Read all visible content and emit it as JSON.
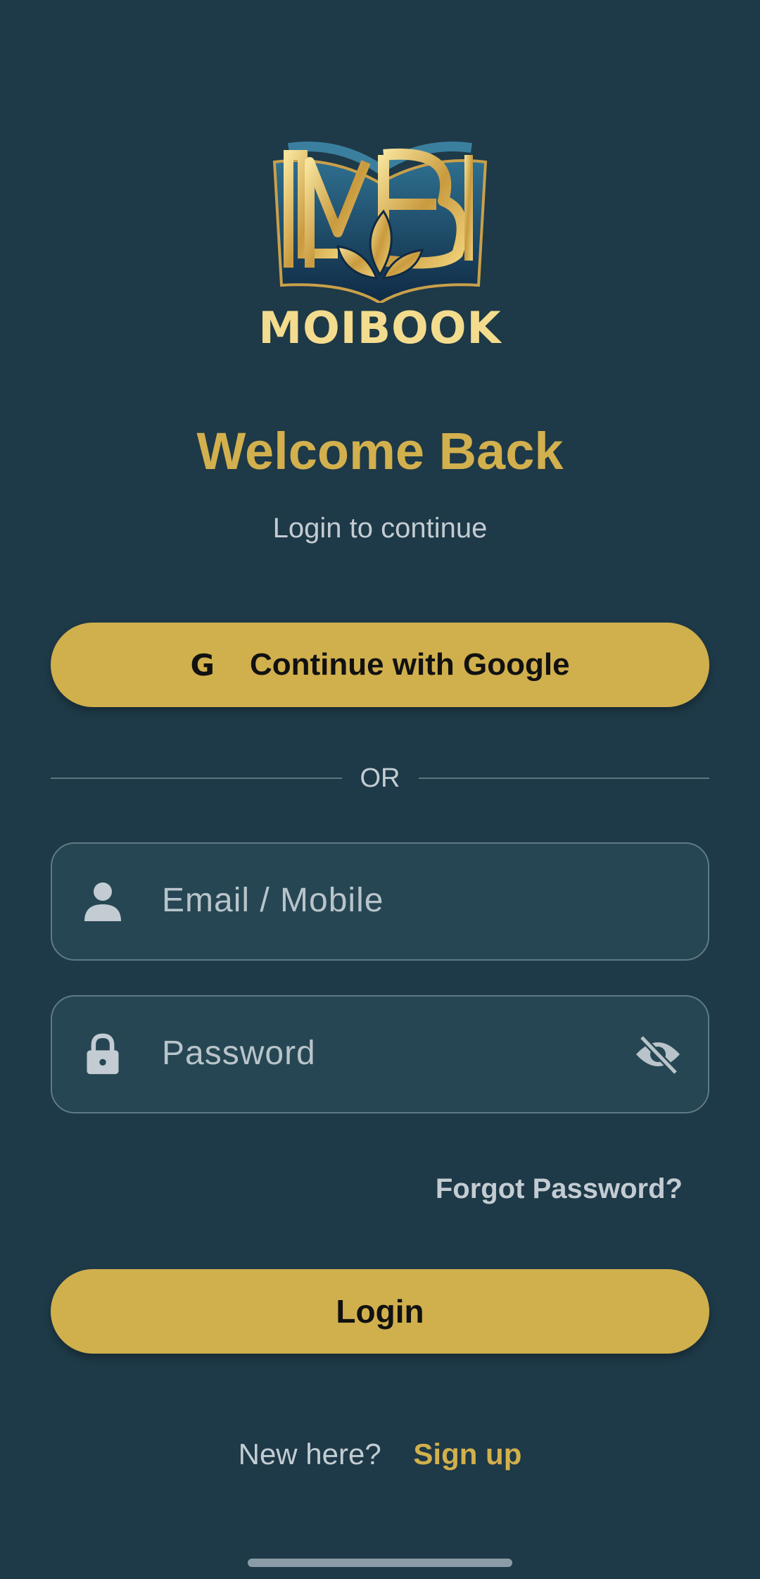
{
  "brand": {
    "name": "MOIBOOK",
    "logo_icon": "book-mb-leaf-logo"
  },
  "header": {
    "title": "Welcome Back",
    "subtitle": "Login to continue"
  },
  "google_button": {
    "icon_glyph": "G",
    "label": "Continue with Google"
  },
  "divider": {
    "label": "OR"
  },
  "email_field": {
    "placeholder": "Email / Mobile",
    "value": "",
    "icon": "person-icon"
  },
  "password_field": {
    "placeholder": "Password",
    "value": "",
    "icon": "lock-icon",
    "toggle_icon": "eye-off-icon"
  },
  "forgot_password": {
    "label": "Forgot Password?"
  },
  "login_button": {
    "label": "Login"
  },
  "signup": {
    "prompt": "New here?",
    "link_label": "Sign up"
  },
  "colors": {
    "background": "#1e3947",
    "accent_gold": "#d0af4d",
    "field_background": "#264653",
    "muted_text": "#c3ccd2"
  }
}
